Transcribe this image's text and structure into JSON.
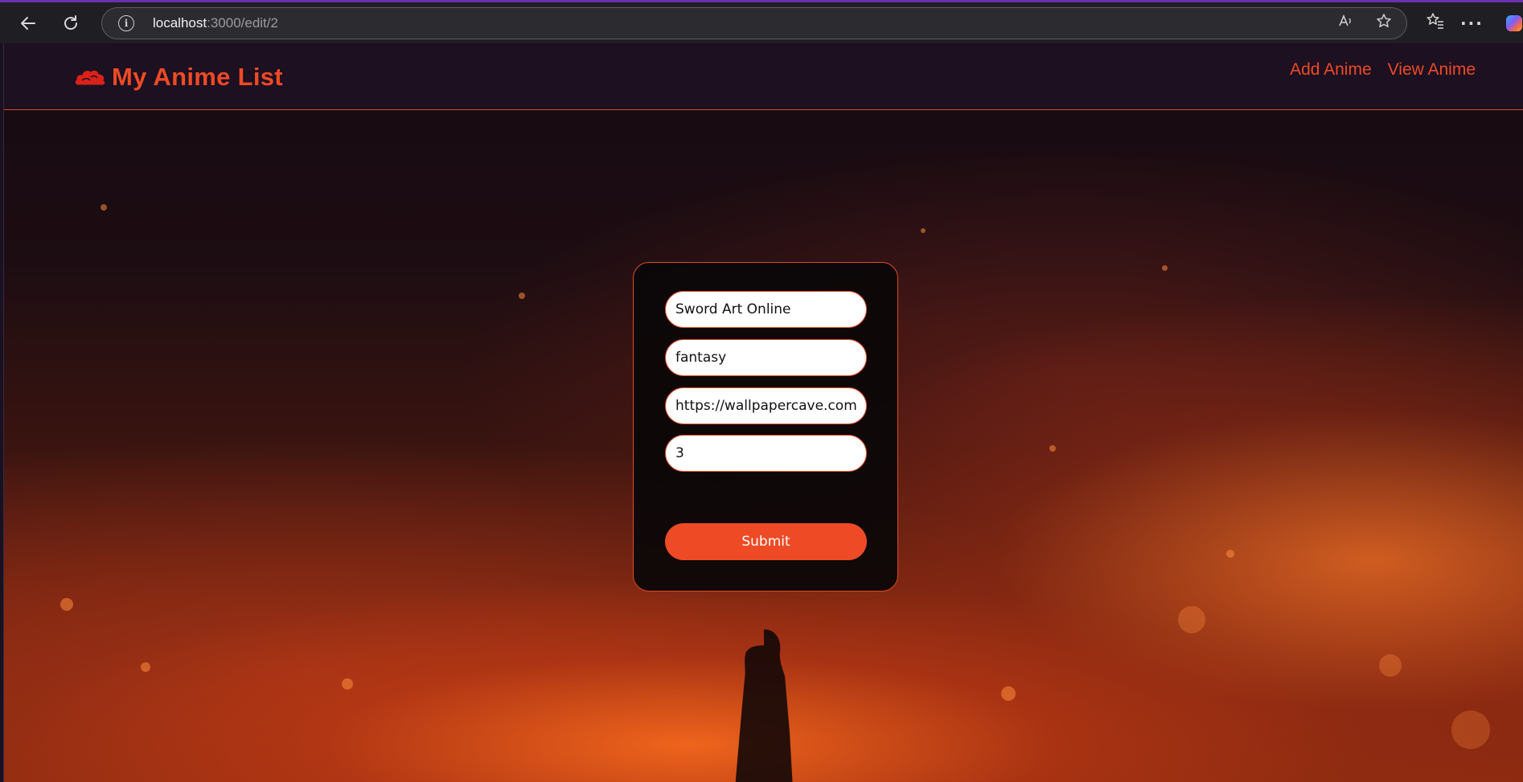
{
  "browser": {
    "url_host": "localhost",
    "url_path": ":3000/edit/2"
  },
  "navbar": {
    "brand_title": "My Anime List",
    "brand_icon": "red-cloud-icon",
    "links": [
      "Add Anime",
      "View Anime"
    ]
  },
  "form": {
    "title_value": "Sword Art Online",
    "genre_value": "fantasy",
    "image_url_value": "https://wallpapercave.com",
    "rating_value": "3",
    "submit_label": "Submit"
  },
  "colors": {
    "accent": "#ee4a26",
    "navbar_bg": "#1c1021",
    "card_bg": "#0a0608"
  }
}
